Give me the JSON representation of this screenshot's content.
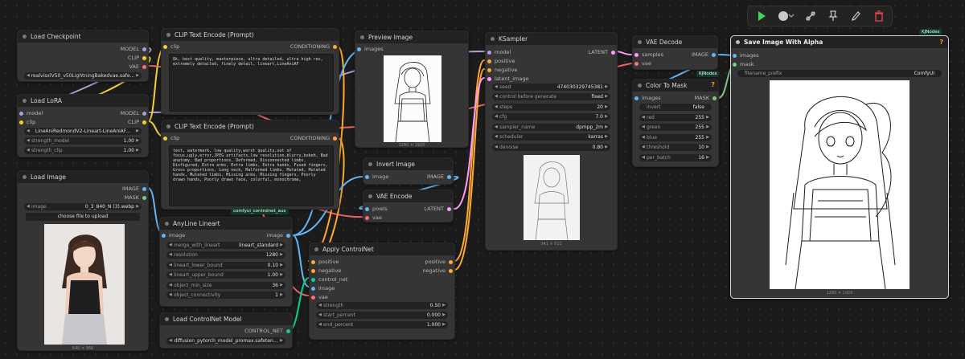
{
  "colors": {
    "model": "#b39ddb",
    "clip": "#f5d033",
    "vae": "#ff6e6e",
    "conditioning": "#ffa931",
    "latent": "#ff9cf9",
    "image": "#64b5f6",
    "mask": "#81c784",
    "control_net": "#00d78d"
  },
  "toolbar": {
    "icons": [
      "play-icon",
      "status-dot-icon",
      "chevron-down-icon",
      "link-icon",
      "pin-icon",
      "pencil-icon",
      "trash-icon"
    ]
  },
  "nodes": {
    "load_checkpoint": {
      "title": "Load Checkpoint",
      "outputs": [
        "MODEL",
        "CLIP",
        "VAE"
      ],
      "ckpt_name": "realvisxlV50_v50LightningBakedvae.safe..."
    },
    "load_lora": {
      "title": "Load LoRA",
      "inputs": [
        "model",
        "clip"
      ],
      "outputs": [
        "MODEL",
        "CLIP"
      ],
      "lora_name": "LineAniRedmondV2-Lineart-LineAniAF...",
      "strength_model": {
        "label": "strength_model",
        "value": "1.00"
      },
      "strength_clip": {
        "label": "strength_clip",
        "value": "1.00"
      }
    },
    "clip_text_pos": {
      "title": "CLIP Text Encode (Prompt)",
      "input": "clip",
      "output": "CONDITIONING",
      "text": "8k, best quality, masterpiece, ultra detailed, ultra high res, extremely detailed, finely detail, lineart,LineAniAF"
    },
    "clip_text_neg": {
      "title": "CLIP Text Encode (Prompt)",
      "input": "clip",
      "output": "CONDITIONING",
      "text": "text, watermark, low quality,worst quality,out of focus,ugly,error,JPEG artifacts,low resolution,blurry,bokeh, Bad anatomy, Bad proportions, Deformed, Disconnected limbs, Disfigured, Extra arms, Extra limbs, Extra hands, Fused fingers, Gross proportions, Long neck, Malformed limbs, Mutated, Mutated hands, Mutated limbs, Missing arms, Missing fingers, Poorly drawn hands, Poorly drawn face, colorful, monochrome,",
      "group_badge": "comfyui_controlnet_aux"
    },
    "load_image": {
      "title": "Load Image",
      "outputs": [
        "IMAGE",
        "MASK"
      ],
      "image": {
        "label": "image",
        "value": "0_3_840_N (3).webp"
      },
      "upload": "choose file to upload",
      "caption": "640 × 960"
    },
    "anyline": {
      "title": "AnyLine Lineart",
      "input": "image",
      "output": "image",
      "widgets": [
        {
          "label": "merge_with_lineart",
          "value": "lineart_standard"
        },
        {
          "label": "resolution",
          "value": "1280"
        },
        {
          "label": "lineart_lower_bound",
          "value": "0.10"
        },
        {
          "label": "lineart_upper_bound",
          "value": "1.00"
        },
        {
          "label": "object_min_size",
          "value": "36"
        },
        {
          "label": "object_connectivity",
          "value": "1"
        }
      ]
    },
    "load_controlnet": {
      "title": "Load ControlNet Model",
      "output": "CONTROL_NET",
      "control_net_name": "diffusion_pytorch_model_promax.safeten..."
    },
    "preview_image": {
      "title": "Preview Image",
      "input": "images",
      "caption": "1280 × 1920"
    },
    "invert_image": {
      "title": "Invert Image",
      "input": "image",
      "output": "IMAGE"
    },
    "vae_encode": {
      "title": "VAE Encode",
      "inputs": [
        "pixels",
        "vae"
      ],
      "output": "LATENT"
    },
    "apply_controlnet": {
      "title": "Apply ControlNet",
      "inputs": [
        "positive",
        "negative",
        "control_net",
        "image",
        "vae"
      ],
      "outputs": [
        "positive",
        "negative"
      ],
      "widgets": [
        {
          "label": "strength",
          "value": "0.50"
        },
        {
          "label": "start_percent",
          "value": "0.000"
        },
        {
          "label": "end_percent",
          "value": "1.000"
        }
      ]
    },
    "ksampler": {
      "title": "KSampler",
      "inputs": [
        "model",
        "positive",
        "negative",
        "latent_image"
      ],
      "output": "LATENT",
      "widgets": [
        {
          "label": "seed",
          "value": "474030329745381"
        },
        {
          "label": "control before generate",
          "value": "fixed"
        },
        {
          "label": "steps",
          "value": "20"
        },
        {
          "label": "cfg",
          "value": "7.0"
        },
        {
          "label": "sampler_name",
          "value": "dpmpp_2m"
        },
        {
          "label": "scheduler",
          "value": "karras"
        },
        {
          "label": "denoise",
          "value": "0.80"
        }
      ],
      "caption": "341 × 512"
    },
    "vae_decode": {
      "title": "VAE Decode",
      "inputs": [
        "samples",
        "vae"
      ],
      "output": "IMAGE",
      "badge": "KJNodes"
    },
    "color_to_mask": {
      "title": "Color To Mask",
      "input": "images",
      "output": "MASK",
      "widgets": [
        {
          "label": "invert",
          "value": "false",
          "toggle": true
        },
        {
          "label": "red",
          "value": "255"
        },
        {
          "label": "green",
          "value": "255"
        },
        {
          "label": "blue",
          "value": "255"
        },
        {
          "label": "threshold",
          "value": "10"
        },
        {
          "label": "per_batch",
          "value": "16"
        }
      ],
      "help": "?"
    },
    "save_image_alpha": {
      "title": "Save Image With Alpha",
      "inputs": [
        "images",
        "mask"
      ],
      "filename_prefix": {
        "label": "filename_prefix",
        "value": "ComfyUI"
      },
      "caption": "1280 × 1920",
      "badge": "KJNodes",
      "help": "?"
    }
  }
}
